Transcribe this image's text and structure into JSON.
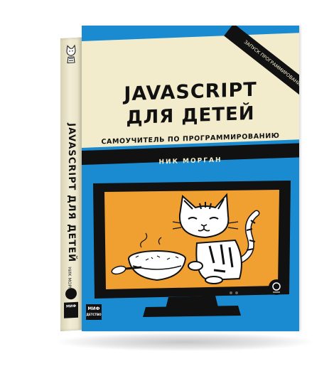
{
  "book": {
    "title_line1": "JAVASCRIPT",
    "title_line2": "ДЛЯ ДЕТЕЙ",
    "subtitle": "САМОУЧИТЕЛЬ ПО ПРОГРАММИРОВАНИЮ",
    "author": "НИК МОРГАН",
    "corner_badge": "ЗАПУСК ПРОГРАММИРОВАНИЯ",
    "spine_title": "JAVASCRIPT ДЛЯ ДЕТЕЙ",
    "spine_author": "НИК МОРГАН",
    "publisher": "МИФ",
    "publisher_sub": "ДЕТСТВО"
  },
  "colors": {
    "cover_blue": "#1a8bd0",
    "cream": "#f2eccd",
    "screen_orange": "#f0a030",
    "black": "#111111"
  },
  "icons": [
    "cat-illustration",
    "bowl-icon",
    "spoon-icon",
    "publisher-logo",
    "press-badge-icon"
  ]
}
